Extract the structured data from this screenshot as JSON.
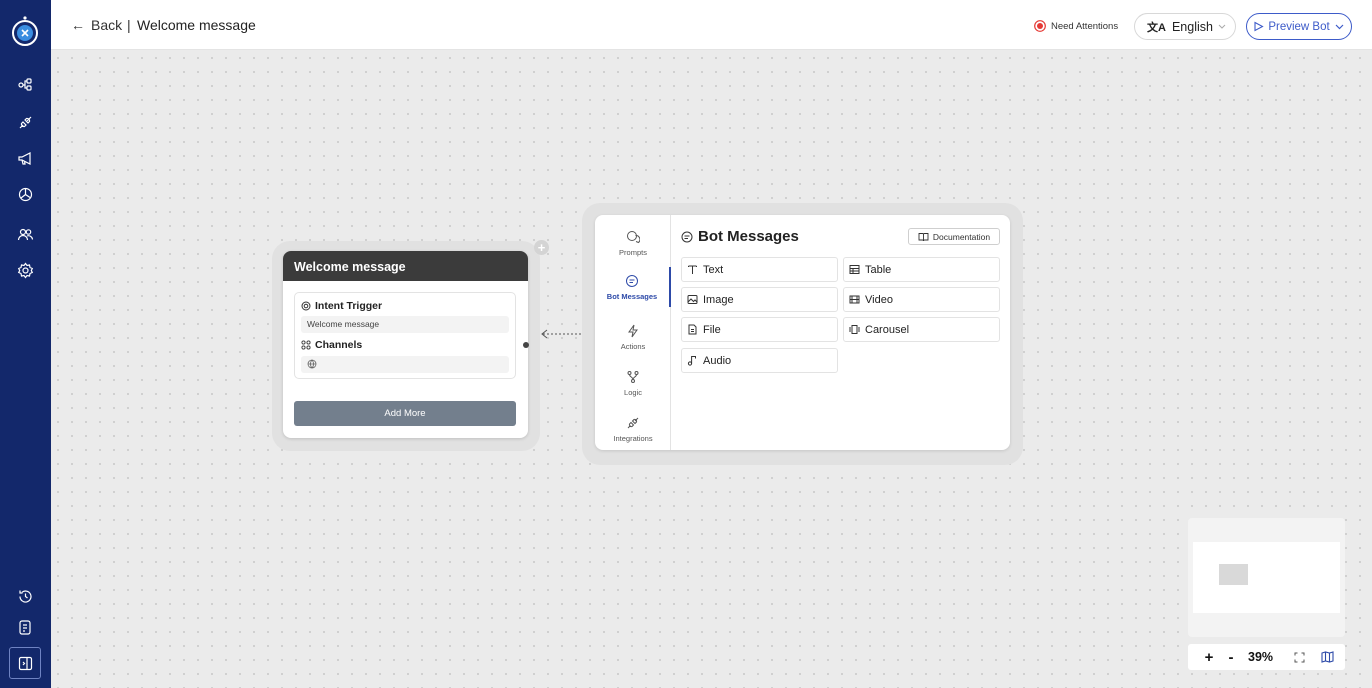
{
  "header": {
    "back_label": "Back",
    "separator": "|",
    "page_title": "Welcome message",
    "attention_label": "Need Attentions",
    "language": "English",
    "preview_label": "Preview Bot"
  },
  "sidebar": {
    "items": [
      {
        "icon": "flow-icon"
      },
      {
        "icon": "plug-icon"
      },
      {
        "icon": "megaphone-icon"
      },
      {
        "icon": "chart-icon"
      },
      {
        "icon": "users-icon"
      },
      {
        "icon": "settings-icon"
      }
    ],
    "bottom_items": [
      {
        "icon": "history-icon"
      },
      {
        "icon": "document-icon"
      },
      {
        "icon": "collapse-sidebar-icon"
      }
    ]
  },
  "node": {
    "title": "Welcome message",
    "intent_label": "Intent Trigger",
    "intent_value": "Welcome message",
    "channels_label": "Channels",
    "add_more_label": "Add More"
  },
  "panel": {
    "tabs": [
      {
        "label": "Prompts"
      },
      {
        "label": "Bot Messages"
      },
      {
        "label": "Actions"
      },
      {
        "label": "Logic"
      },
      {
        "label": "Integrations"
      }
    ],
    "title": "Bot Messages",
    "doc_label": "Documentation",
    "options": [
      {
        "label": "Text"
      },
      {
        "label": "Table"
      },
      {
        "label": "Image"
      },
      {
        "label": "Video"
      },
      {
        "label": "File"
      },
      {
        "label": "Carousel"
      },
      {
        "label": "Audio"
      }
    ]
  },
  "zoom": {
    "plus": "+",
    "minus": "-",
    "level": "39%"
  },
  "colors": {
    "sidebar": "#13286b",
    "accent": "#3d5bc9",
    "attention": "#e53935",
    "node_header": "#3b3b3b",
    "add_more": "#737f8d"
  }
}
